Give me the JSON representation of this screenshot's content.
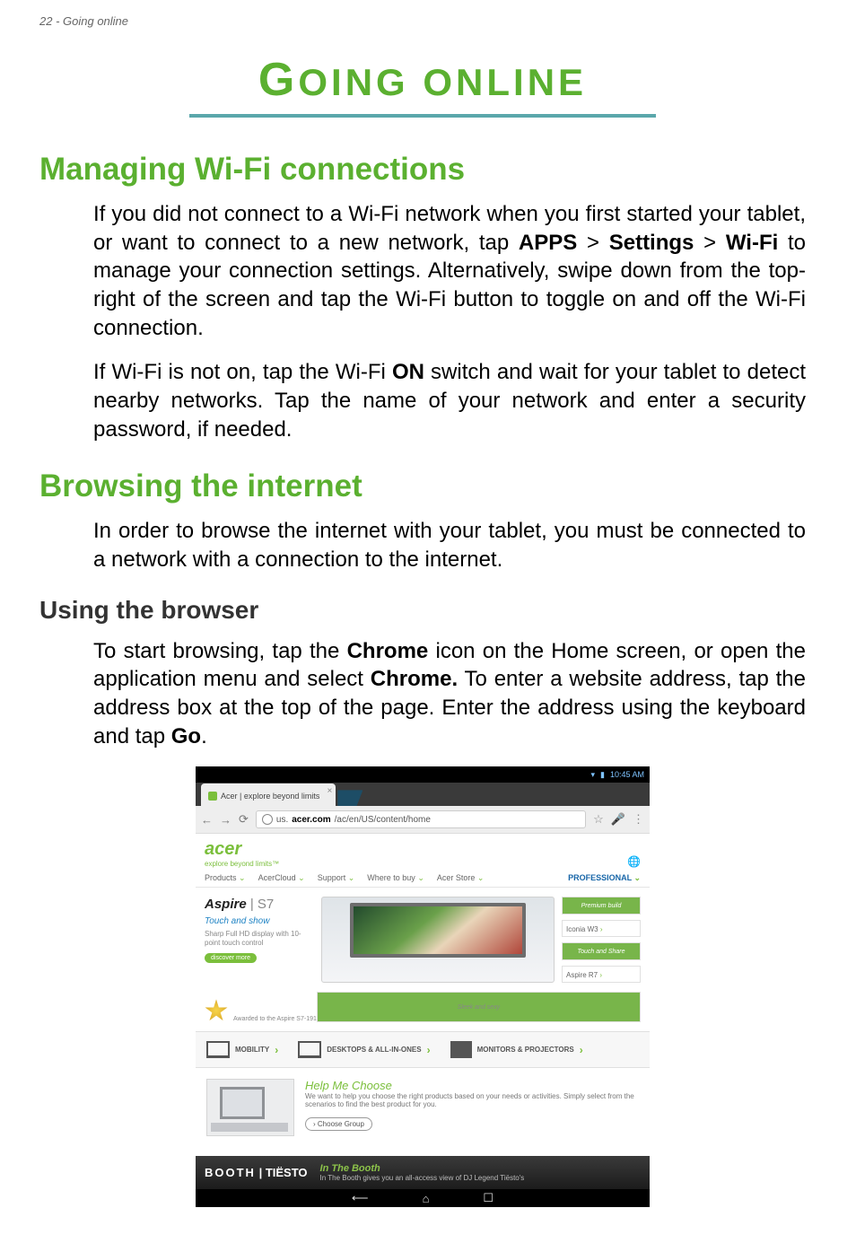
{
  "running_head": "22 - Going online",
  "chapter_title_big": "G",
  "chapter_title_rest": "OING ONLINE",
  "sections": {
    "wifi": {
      "heading": "Managing Wi-Fi connections",
      "para1_a": "If you did not connect to a Wi-Fi network when you first started your tablet, or want to connect to a new network, tap ",
      "apps": "APPS",
      "gt1": " > ",
      "settings": "Settings",
      "gt2": " > ",
      "wifi": "Wi-Fi",
      "para1_b": " to manage your connection settings. Alternatively, swipe down from the top-right of the screen and tap the Wi-Fi button to toggle on and off the Wi-Fi connection.",
      "para2_a": "If Wi-Fi is not on, tap the Wi-Fi ",
      "on": "ON",
      "para2_b": " switch and wait for your tablet to detect nearby networks. Tap the name of your network and enter a security password, if needed."
    },
    "browse": {
      "heading": "Browsing the internet",
      "para1": "In order to browse the internet with your tablet, you must be connected to a network with a connection to the internet.",
      "sub": "Using the browser",
      "para2_a": "To start browsing, tap the ",
      "chrome1": "Chrome",
      "para2_b": " icon on the Home screen, or open the application menu and select ",
      "chrome2": "Chrome.",
      "para2_c": " To enter a website address, tap the address box at the top of the page. Enter the address using the keyboard and tap ",
      "go": "Go",
      "para2_d": "."
    }
  },
  "figure": {
    "status_time": "10:45 AM",
    "tab_title": "Acer | explore beyond limits",
    "url_pre": "us.",
    "url_host": "acer.com",
    "url_path": "/ac/en/US/content/home",
    "brand": "acer",
    "brand_tag": "explore beyond limits™",
    "nav": {
      "products": "Products",
      "acercloud": "AcerCloud",
      "support": "Support",
      "wheretobuy": "Where to buy",
      "acerstore": "Acer Store",
      "professional": "PROFESSIONAL"
    },
    "hero": {
      "aspire": "Aspire",
      "s7": " | S7",
      "touchshow": "Touch and show",
      "desc": "Sharp Full HD display with 10-point touch control",
      "discover": "discover more",
      "premium_build": "Premium build",
      "touch_and_share": "Touch and Share",
      "sleek_and_sexy": "Sleek and sexy",
      "iconia": "Iconia W3",
      "aspire_r7": "Aspire R7",
      "award": "Awarded to the Aspire S7-191"
    },
    "cats": {
      "mobility": "MOBILITY",
      "desktops": "DESKTOPS & ALL-IN-ONES",
      "monitors": "MONITORS & PROJECTORS"
    },
    "help": {
      "title": "Help Me Choose",
      "copy": "We want to help you choose the right products based on your needs or activities. Simply select from the scenarios to find the best product for you.",
      "choose": "Choose Group"
    },
    "banner": {
      "booth": "BOOTH",
      "tiesto": "TIËSTO",
      "headline": "In The Booth",
      "sub": "In The Booth gives you an all-access view of DJ Legend Tiësto's"
    }
  }
}
